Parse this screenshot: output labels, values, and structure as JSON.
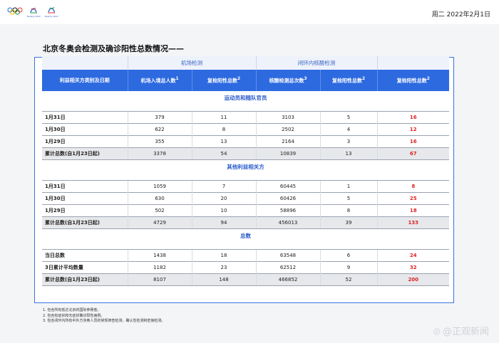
{
  "header": {
    "logos": [
      {
        "icon": "olympic-rings-icon",
        "caption": ""
      },
      {
        "icon": "beijing-2022-olympic-emblem-icon",
        "caption": "Beijing 2022"
      },
      {
        "icon": "beijing-2022-paralympic-emblem-icon",
        "caption": "Beijing 2022"
      }
    ],
    "date": "周二 2022年2月1日"
  },
  "title": "北京冬奥会检测及确诊阳性总数情况——",
  "table": {
    "group_airport": "机场检测",
    "group_closed_loop": "闭环内核酸检测",
    "col_category": "利益相关方类别及日期",
    "col_arrivals": "机场入境总人数",
    "col_airport_pos": "复检阳性总数",
    "col_tests": "核酸检测总次数",
    "col_loop_pos": "复检阳性总数",
    "col_total_pos": "复检阳性总数",
    "sup_arrivals": "1",
    "sup_airport_pos": "2",
    "sup_tests": "3",
    "sup_loop_pos": "2",
    "sup_total_pos": "2",
    "sections": [
      {
        "title": "运动员和随队官员",
        "rows": [
          {
            "label": "1月31日",
            "arrivals": "379",
            "airport_pos": "11",
            "tests": "3103",
            "loop_pos": "5",
            "total_pos": "16"
          },
          {
            "label": "1月30日",
            "arrivals": "622",
            "airport_pos": "8",
            "tests": "2502",
            "loop_pos": "4",
            "total_pos": "12"
          },
          {
            "label": "1月29日",
            "arrivals": "355",
            "airport_pos": "13",
            "tests": "2164",
            "loop_pos": "3",
            "total_pos": "16"
          },
          {
            "label": "累计总数(自1月23日起)",
            "arrivals": "3378",
            "airport_pos": "54",
            "tests": "10839",
            "loop_pos": "13",
            "total_pos": "67"
          }
        ]
      },
      {
        "title": "其他利益相关方",
        "rows": [
          {
            "label": "1月31日",
            "arrivals": "1059",
            "airport_pos": "7",
            "tests": "60445",
            "loop_pos": "1",
            "total_pos": "8"
          },
          {
            "label": "1月30日",
            "arrivals": "630",
            "airport_pos": "20",
            "tests": "60426",
            "loop_pos": "5",
            "total_pos": "25"
          },
          {
            "label": "1月29日",
            "arrivals": "502",
            "airport_pos": "10",
            "tests": "58896",
            "loop_pos": "8",
            "total_pos": "18"
          },
          {
            "label": "累计总数(自1月23日起)",
            "arrivals": "4729",
            "airport_pos": "94",
            "tests": "456013",
            "loop_pos": "39",
            "total_pos": "133"
          }
        ]
      },
      {
        "title": "总数",
        "rows": [
          {
            "label": "当日总数",
            "arrivals": "1438",
            "airport_pos": "18",
            "tests": "63548",
            "loop_pos": "6",
            "total_pos": "24"
          },
          {
            "label": "3日累计平均数量",
            "arrivals": "1182",
            "airport_pos": "23",
            "tests": "62512",
            "loop_pos": "9",
            "total_pos": "32"
          },
          {
            "label": "累计总数(自1月23日起)",
            "arrivals": "8107",
            "airport_pos": "148",
            "tests": "466852",
            "loop_pos": "52",
            "total_pos": "200"
          }
        ]
      }
    ]
  },
  "notes": [
    "1. 包含所有抵达北京的国际参赛者。",
    "2. 包含有症状和无症状确诊阳性病例。",
    "3. 包含闭环内所有中外方涉奥人员的常规筛查检测，确认性检测和密接检测。"
  ],
  "watermark": {
    "icon": "weibo-icon",
    "text": "@正观新闻"
  },
  "colors": {
    "header_blue": "#2d6ae0",
    "frame_blue": "#3a73dd",
    "positive_red": "#dd2222"
  }
}
